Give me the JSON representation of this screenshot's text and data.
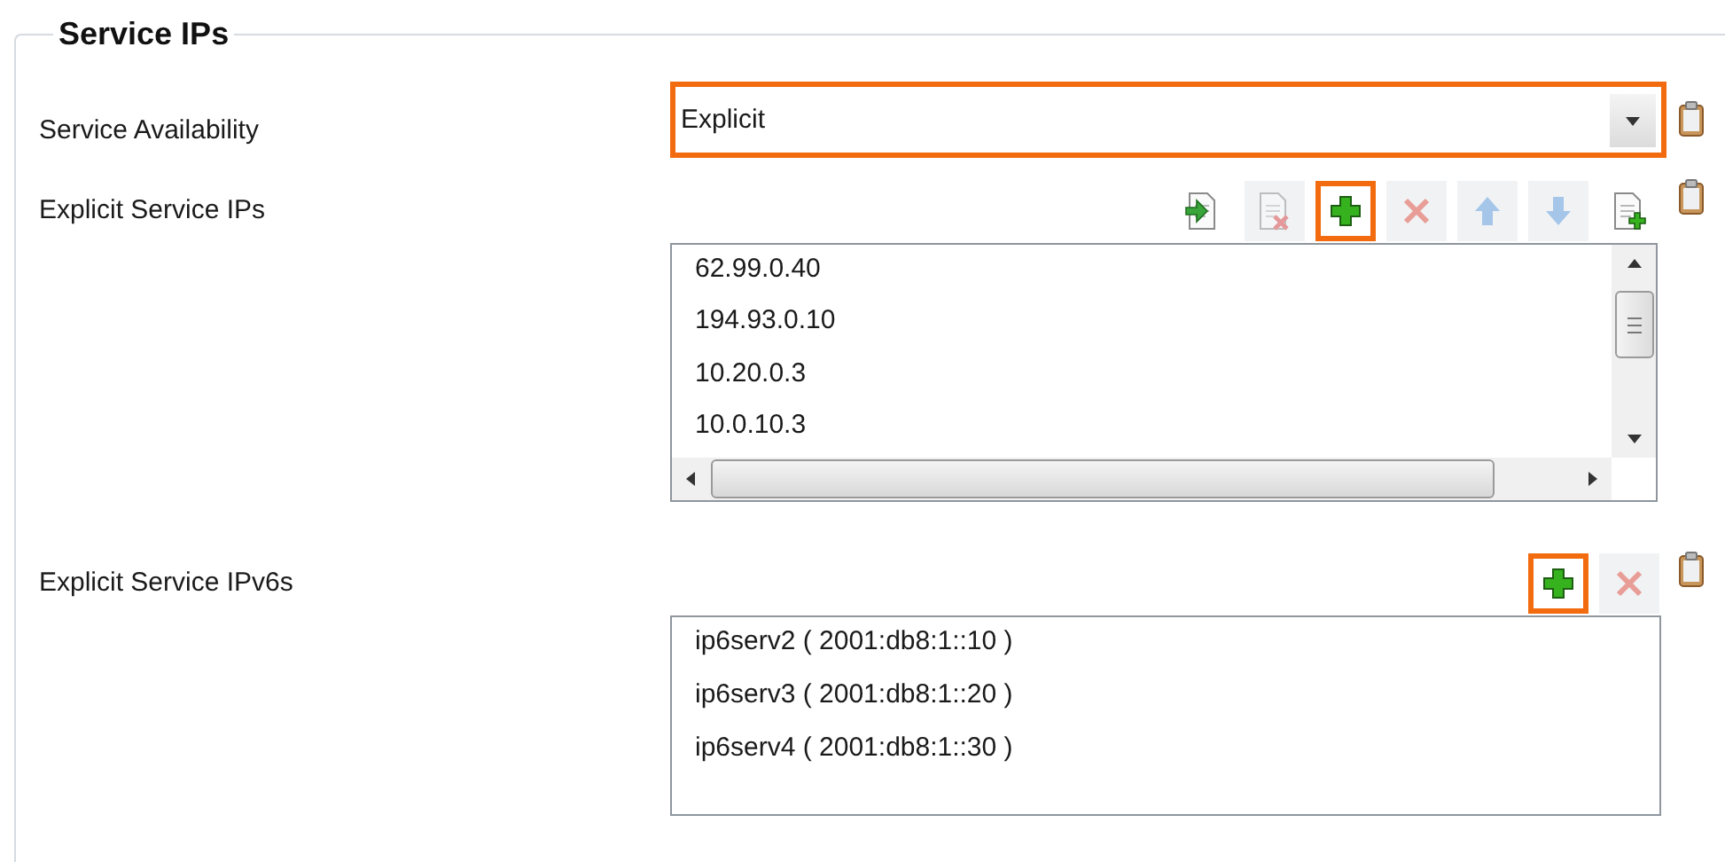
{
  "group": {
    "title": "Service IPs"
  },
  "fields": [
    {
      "label": "Service Availability",
      "kind": "dropdown",
      "value": "Explicit",
      "highlighted": true
    },
    {
      "label": "Explicit Service IPs",
      "kind": "list",
      "scrollable": true,
      "toolbar": [
        {
          "kind": "import",
          "disabled": false,
          "highlighted": false
        },
        {
          "kind": "delete-document",
          "disabled": true,
          "highlighted": false
        },
        {
          "kind": "add",
          "disabled": false,
          "highlighted": true
        },
        {
          "kind": "remove",
          "disabled": true,
          "highlighted": false
        },
        {
          "kind": "move-up",
          "disabled": true,
          "highlighted": false
        },
        {
          "kind": "move-down",
          "disabled": true,
          "highlighted": false
        },
        {
          "kind": "new-document",
          "disabled": false,
          "highlighted": false
        }
      ],
      "items": [
        "62.99.0.40",
        "194.93.0.10",
        "10.20.0.3",
        "10.0.10.3"
      ]
    },
    {
      "label": "Explicit Service IPv6s",
      "kind": "list",
      "scrollable": false,
      "toolbar": [
        {
          "kind": "add",
          "disabled": false,
          "highlighted": true
        },
        {
          "kind": "remove",
          "disabled": true,
          "highlighted": false
        }
      ],
      "items": [
        "ip6serv2 ( 2001:db8:1::10 )",
        "ip6serv3 ( 2001:db8:1::20 )",
        "ip6serv4 ( 2001:db8:1::30 )"
      ]
    }
  ]
}
